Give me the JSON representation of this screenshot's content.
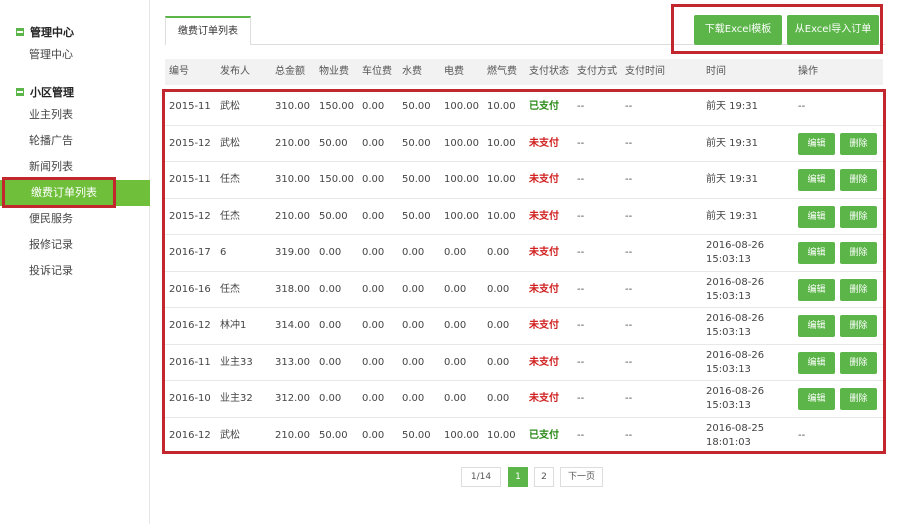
{
  "sidebar": {
    "groups": [
      {
        "label": "管理中心",
        "items": [
          "管理中心"
        ]
      },
      {
        "label": "小区管理",
        "items": [
          "业主列表",
          "轮播广告",
          "新闻列表",
          "缴费订单列表",
          "便民服务",
          "报修记录",
          "投诉记录"
        ]
      }
    ],
    "active_item": "缴费订单列表"
  },
  "tab": {
    "label": "缴费订单列表"
  },
  "toolbar": {
    "download_label": "下载Excel模板",
    "import_label": "从Excel导入订单"
  },
  "table": {
    "headers": [
      "编号",
      "发布人",
      "总金额",
      "物业费",
      "车位费",
      "水费",
      "电费",
      "燃气费",
      "支付状态",
      "支付方式",
      "支付时间",
      "时间",
      "操作"
    ],
    "rows": [
      {
        "id": "2015-11",
        "publisher": "武松",
        "total": "310.00",
        "property": "150.00",
        "parking": "0.00",
        "water": "50.00",
        "electric": "100.00",
        "gas": "10.00",
        "status": "已支付",
        "method": "--",
        "paytime": "--",
        "time1": "前天 19:31",
        "time2": "",
        "action": "--"
      },
      {
        "id": "2015-12",
        "publisher": "武松",
        "total": "210.00",
        "property": "50.00",
        "parking": "0.00",
        "water": "50.00",
        "electric": "100.00",
        "gas": "10.00",
        "status": "未支付",
        "method": "--",
        "paytime": "--",
        "time1": "前天 19:31",
        "time2": "",
        "action": "buttons"
      },
      {
        "id": "2015-11",
        "publisher": "任杰",
        "total": "310.00",
        "property": "150.00",
        "parking": "0.00",
        "water": "50.00",
        "electric": "100.00",
        "gas": "10.00",
        "status": "未支付",
        "method": "--",
        "paytime": "--",
        "time1": "前天 19:31",
        "time2": "",
        "action": "buttons"
      },
      {
        "id": "2015-12",
        "publisher": "任杰",
        "total": "210.00",
        "property": "50.00",
        "parking": "0.00",
        "water": "50.00",
        "electric": "100.00",
        "gas": "10.00",
        "status": "未支付",
        "method": "--",
        "paytime": "--",
        "time1": "前天 19:31",
        "time2": "",
        "action": "buttons"
      },
      {
        "id": "2016-17",
        "publisher": "6",
        "total": "319.00",
        "property": "0.00",
        "parking": "0.00",
        "water": "0.00",
        "electric": "0.00",
        "gas": "0.00",
        "status": "未支付",
        "method": "--",
        "paytime": "--",
        "time1": "2016-08-26",
        "time2": "15:03:13",
        "action": "buttons"
      },
      {
        "id": "2016-16",
        "publisher": "任杰",
        "total": "318.00",
        "property": "0.00",
        "parking": "0.00",
        "water": "0.00",
        "electric": "0.00",
        "gas": "0.00",
        "status": "未支付",
        "method": "--",
        "paytime": "--",
        "time1": "2016-08-26",
        "time2": "15:03:13",
        "action": "buttons"
      },
      {
        "id": "2016-12",
        "publisher": "林冲1",
        "total": "314.00",
        "property": "0.00",
        "parking": "0.00",
        "water": "0.00",
        "electric": "0.00",
        "gas": "0.00",
        "status": "未支付",
        "method": "--",
        "paytime": "--",
        "time1": "2016-08-26",
        "time2": "15:03:13",
        "action": "buttons"
      },
      {
        "id": "2016-11",
        "publisher": "业主33",
        "total": "313.00",
        "property": "0.00",
        "parking": "0.00",
        "water": "0.00",
        "electric": "0.00",
        "gas": "0.00",
        "status": "未支付",
        "method": "--",
        "paytime": "--",
        "time1": "2016-08-26",
        "time2": "15:03:13",
        "action": "buttons"
      },
      {
        "id": "2016-10",
        "publisher": "业主32",
        "total": "312.00",
        "property": "0.00",
        "parking": "0.00",
        "water": "0.00",
        "electric": "0.00",
        "gas": "0.00",
        "status": "未支付",
        "method": "--",
        "paytime": "--",
        "time1": "2016-08-26",
        "time2": "15:03:13",
        "action": "buttons"
      },
      {
        "id": "2016-12",
        "publisher": "武松",
        "total": "210.00",
        "property": "50.00",
        "parking": "0.00",
        "water": "50.00",
        "electric": "100.00",
        "gas": "10.00",
        "status": "已支付",
        "method": "--",
        "paytime": "--",
        "time1": "2016-08-25",
        "time2": "18:01:03",
        "action": "--"
      }
    ],
    "edit_label": "编辑",
    "delete_label": "删除",
    "no_action": "--"
  },
  "pagination": {
    "info": "1/14",
    "pages": [
      "1",
      "2"
    ],
    "current": "1",
    "next_label": "下一页"
  },
  "colors": {
    "accent": "#5bb548",
    "paid": "#2a8a18",
    "unpaid": "#d02020",
    "highlight_border": "#c1272d"
  }
}
